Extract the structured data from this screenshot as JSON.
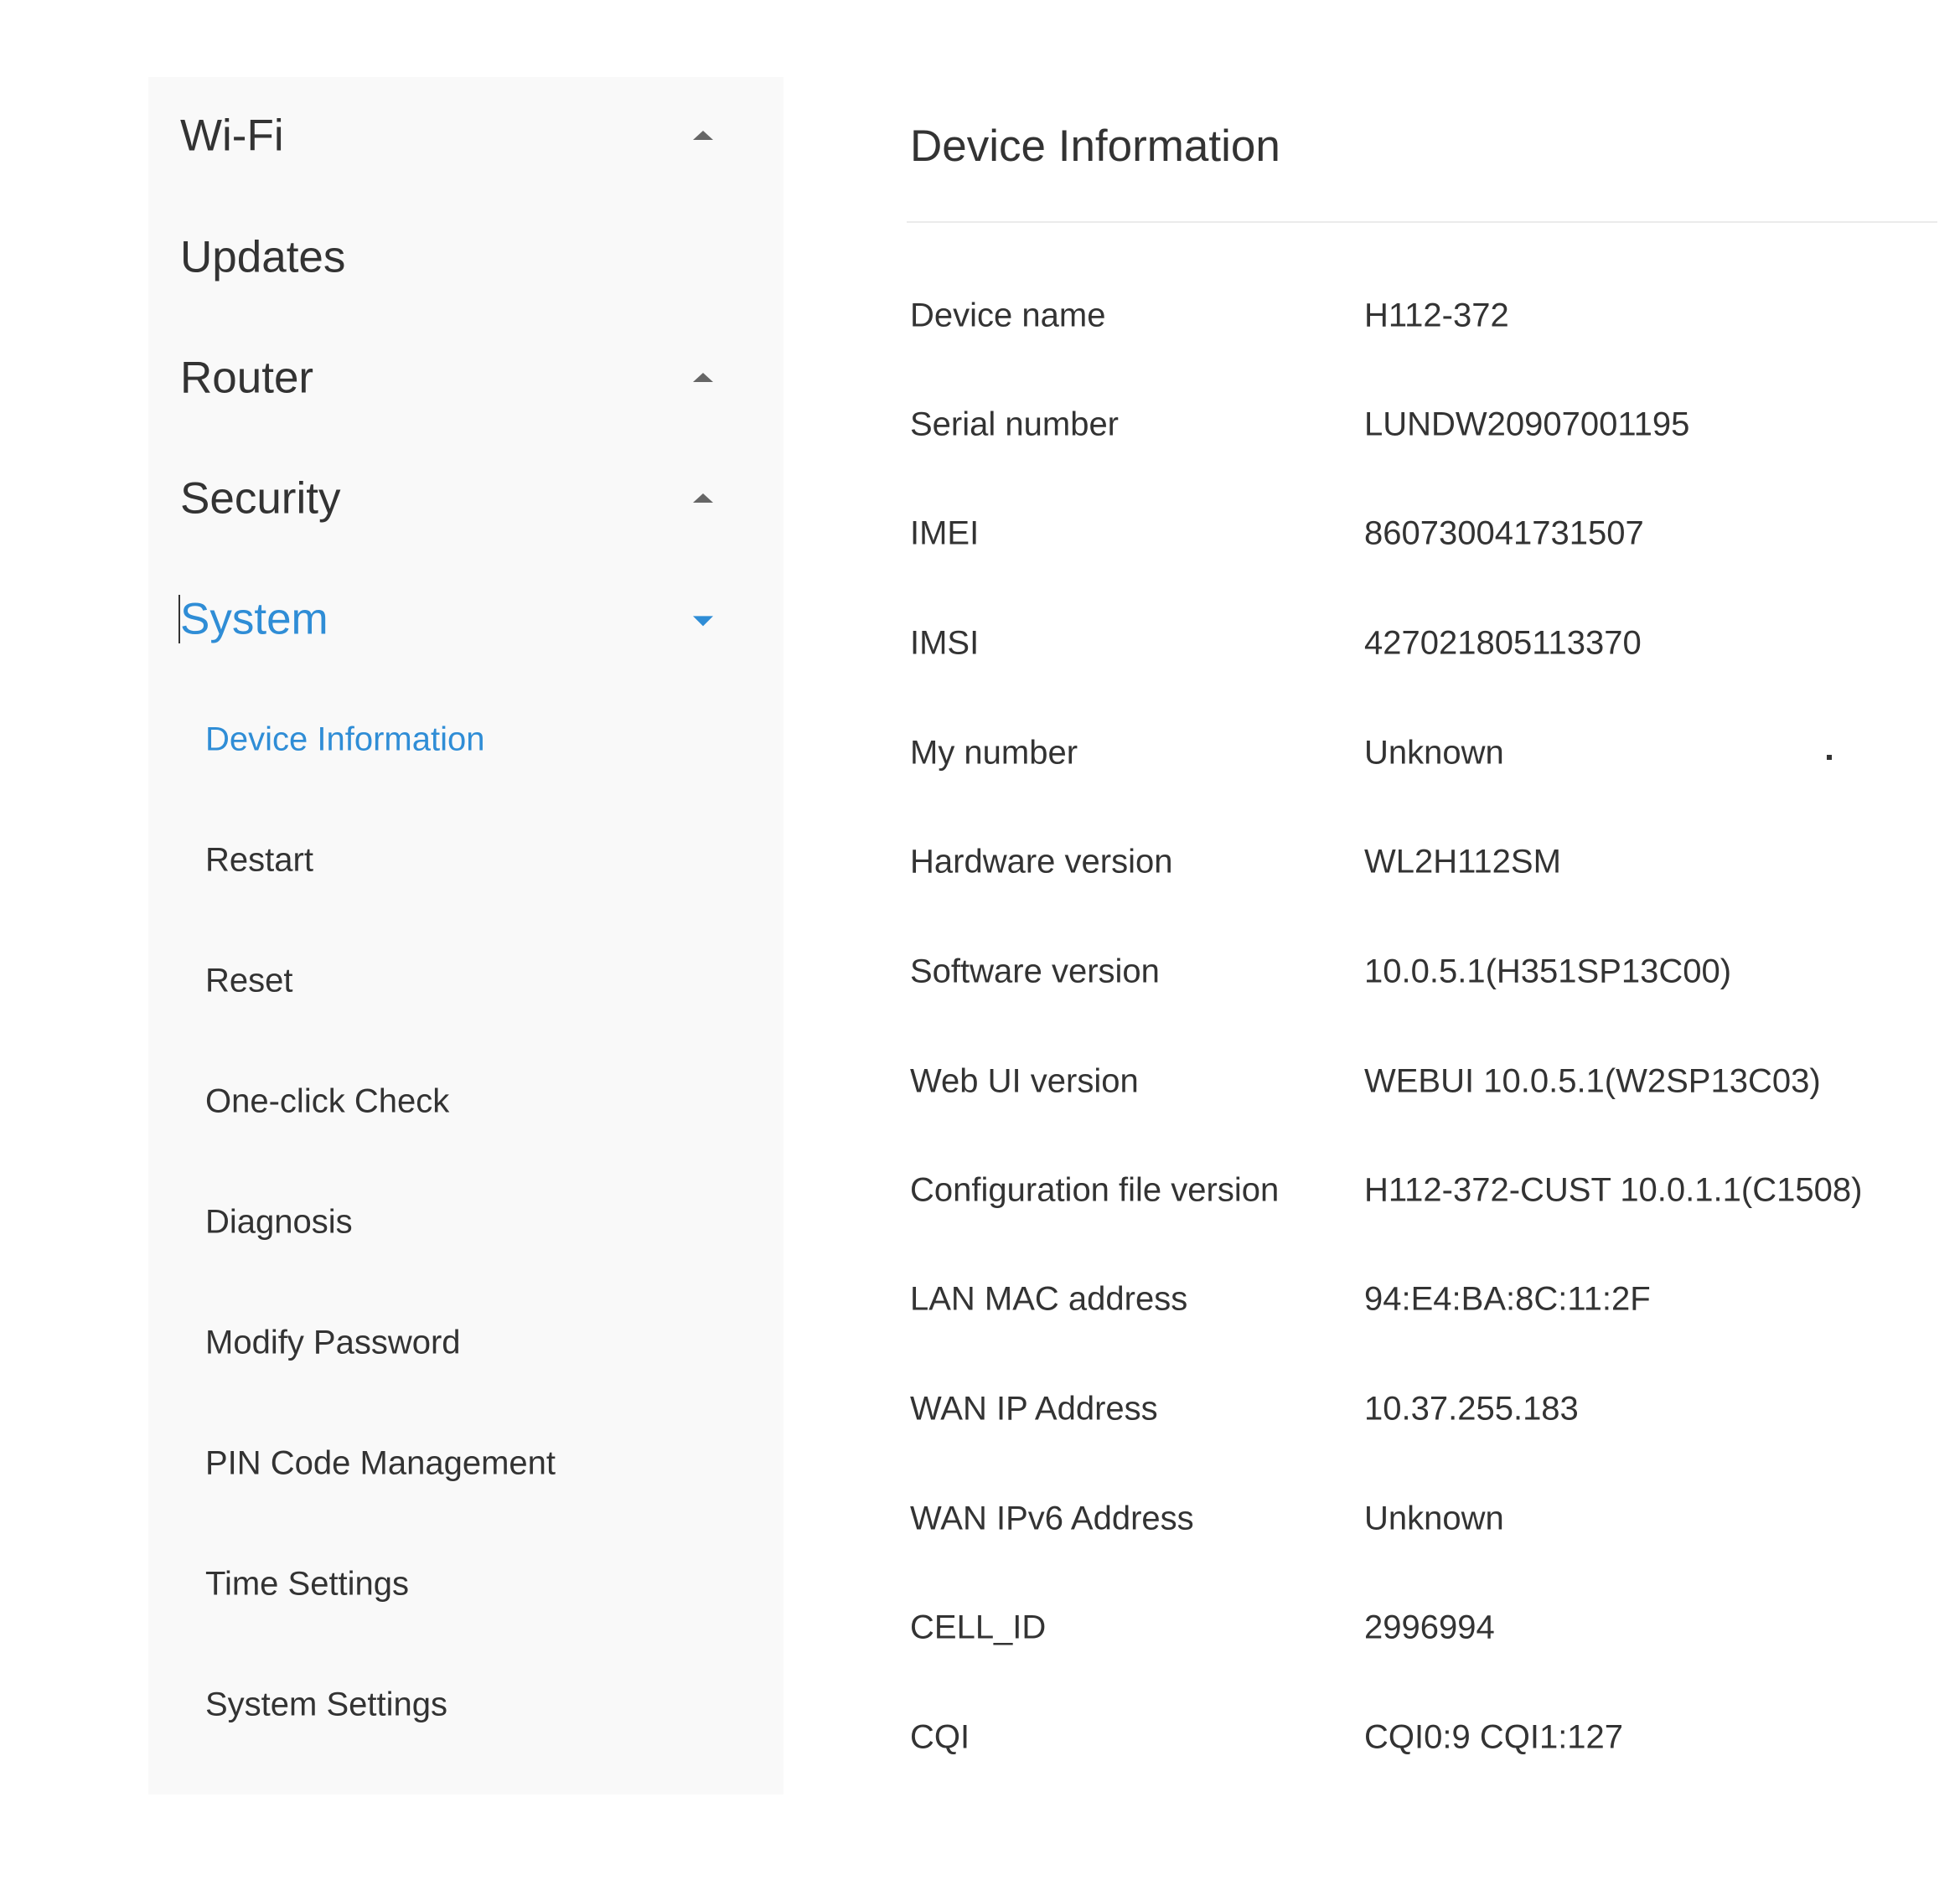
{
  "sidebar": {
    "main_items": [
      {
        "label": "Wi-Fi",
        "expanded": false
      },
      {
        "label": "Updates"
      },
      {
        "label": "Router",
        "expanded": false
      },
      {
        "label": "Security",
        "expanded": false
      },
      {
        "label": "System",
        "expanded": true
      }
    ],
    "system_submenu": [
      {
        "label": "Device Information",
        "active": true
      },
      {
        "label": "Restart"
      },
      {
        "label": "Reset"
      },
      {
        "label": "One-click Check"
      },
      {
        "label": "Diagnosis"
      },
      {
        "label": "Modify Password"
      },
      {
        "label": "PIN Code Management"
      },
      {
        "label": "Time Settings"
      },
      {
        "label": "System Settings"
      }
    ]
  },
  "main": {
    "title": "Device Information",
    "rows": [
      {
        "label": "Device name",
        "value": "H112-372"
      },
      {
        "label": "Serial number",
        "value": "LUNDW20907001195"
      },
      {
        "label": "IMEI",
        "value": "860730041731507"
      },
      {
        "label": "IMSI",
        "value": "427021805113370"
      },
      {
        "label": "My number",
        "value": "Unknown"
      },
      {
        "label": "Hardware version",
        "value": "WL2H112SM"
      },
      {
        "label": "Software version",
        "value": "10.0.5.1(H351SP13C00)"
      },
      {
        "label": "Web UI version",
        "value": "WEBUI 10.0.5.1(W2SP13C03)"
      },
      {
        "label": "Configuration file version",
        "value": "H112-372-CUST 10.0.1.1(C1508)"
      },
      {
        "label": "LAN MAC address",
        "value": "94:E4:BA:8C:11:2F"
      },
      {
        "label": "WAN IP Address",
        "value": "10.37.255.183"
      },
      {
        "label": "WAN IPv6 Address",
        "value": "Unknown"
      },
      {
        "label": "CELL_ID",
        "value": "2996994"
      },
      {
        "label": "CQI",
        "value": "CQI0:9 CQI1:127"
      }
    ]
  },
  "icons": {
    "collapsed": "caret-up-icon",
    "expanded": "caret-down-icon"
  },
  "colors": {
    "accent": "#2f8dd6",
    "text": "#333333",
    "sidebar_bg": "#f9f9f9",
    "divider": "#ebebeb"
  }
}
